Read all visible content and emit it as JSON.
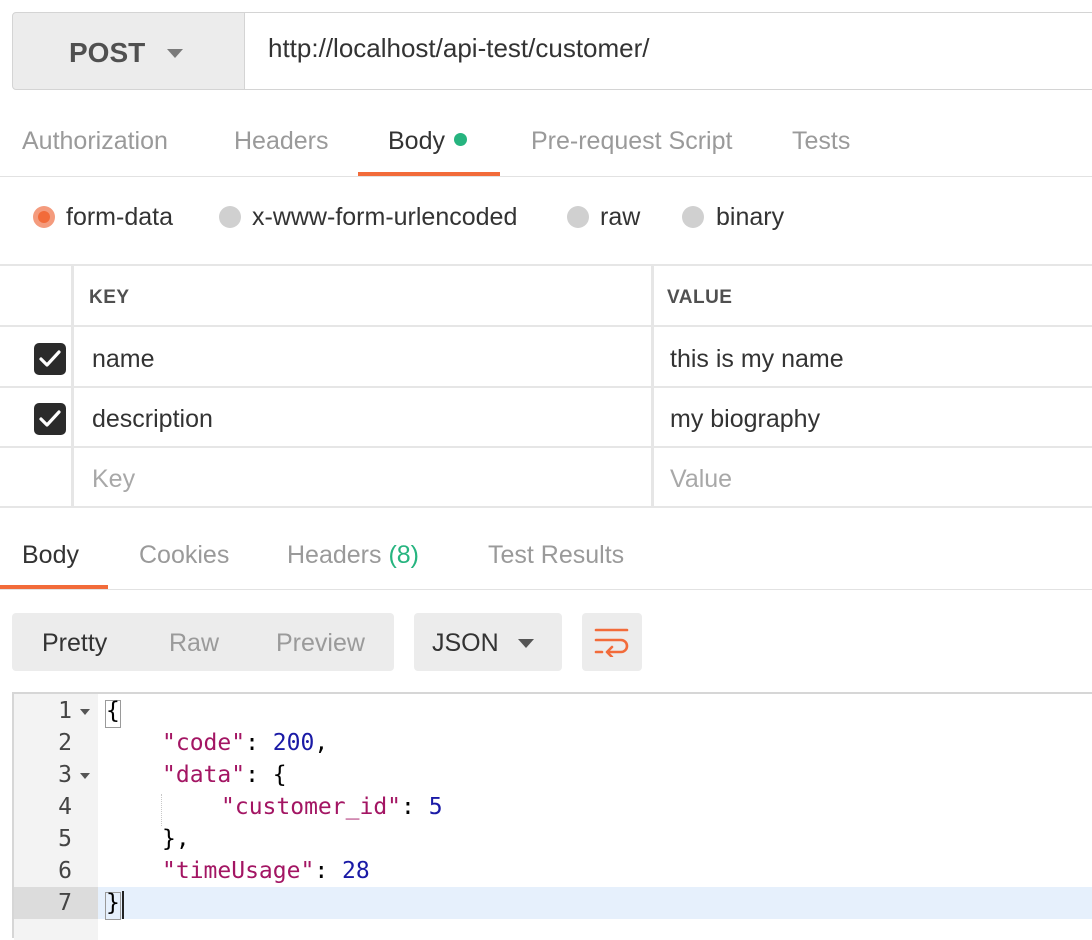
{
  "request": {
    "method": "POST",
    "url": "http://localhost/api-test/customer/"
  },
  "request_tabs": [
    "Authorization",
    "Headers",
    "Body",
    "Pre-request Script",
    "Tests"
  ],
  "body_modes": [
    "form-data",
    "x-www-form-urlencoded",
    "raw",
    "binary"
  ],
  "form_table": {
    "columns": [
      "KEY",
      "VALUE"
    ],
    "rows": [
      {
        "checked": true,
        "key": "name",
        "value": "this is my name"
      },
      {
        "checked": true,
        "key": "description",
        "value": "my biography"
      }
    ],
    "placeholder": {
      "key": "Key",
      "value": "Value"
    }
  },
  "response_tabs": {
    "body": "Body",
    "cookies": "Cookies",
    "headers": "Headers",
    "headers_count": "(8)",
    "tests": "Test Results"
  },
  "view_modes": [
    "Pretty",
    "Raw",
    "Preview"
  ],
  "format": "JSON",
  "line_numbers": [
    "1",
    "2",
    "3",
    "4",
    "5",
    "6",
    "7"
  ],
  "code": {
    "l1": "{",
    "l2_key": "\"code\"",
    "l2_sep": ": ",
    "l2_val": "200",
    "l2_end": ",",
    "l3_key": "\"data\"",
    "l3_rest": ": {",
    "l4_key": "\"customer_id\"",
    "l4_sep": ": ",
    "l4_val": "5",
    "l5": "},",
    "l6_key": "\"timeUsage\"",
    "l6_sep": ": ",
    "l6_val": "28",
    "l7": "}"
  },
  "colors": {
    "accent": "#f26b3a",
    "status_green": "#26b47f",
    "json_key": "#a31563",
    "json_number": "#1a1aa6"
  },
  "icons": [
    "chevron-down-icon",
    "checkmark-icon",
    "wrap-lines-icon",
    "fold-arrow-icon"
  ]
}
